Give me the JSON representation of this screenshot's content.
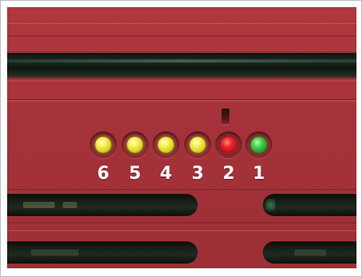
{
  "leds": [
    {
      "label": "6",
      "color": "#e8e42c"
    },
    {
      "label": "5",
      "color": "#e8e42c"
    },
    {
      "label": "4",
      "color": "#e8e42c"
    },
    {
      "label": "3",
      "color": "#e8e42c"
    },
    {
      "label": "2",
      "color": "#e0181f"
    },
    {
      "label": "1",
      "color": "#35c23f"
    }
  ],
  "chassis_color": "#a8343b"
}
